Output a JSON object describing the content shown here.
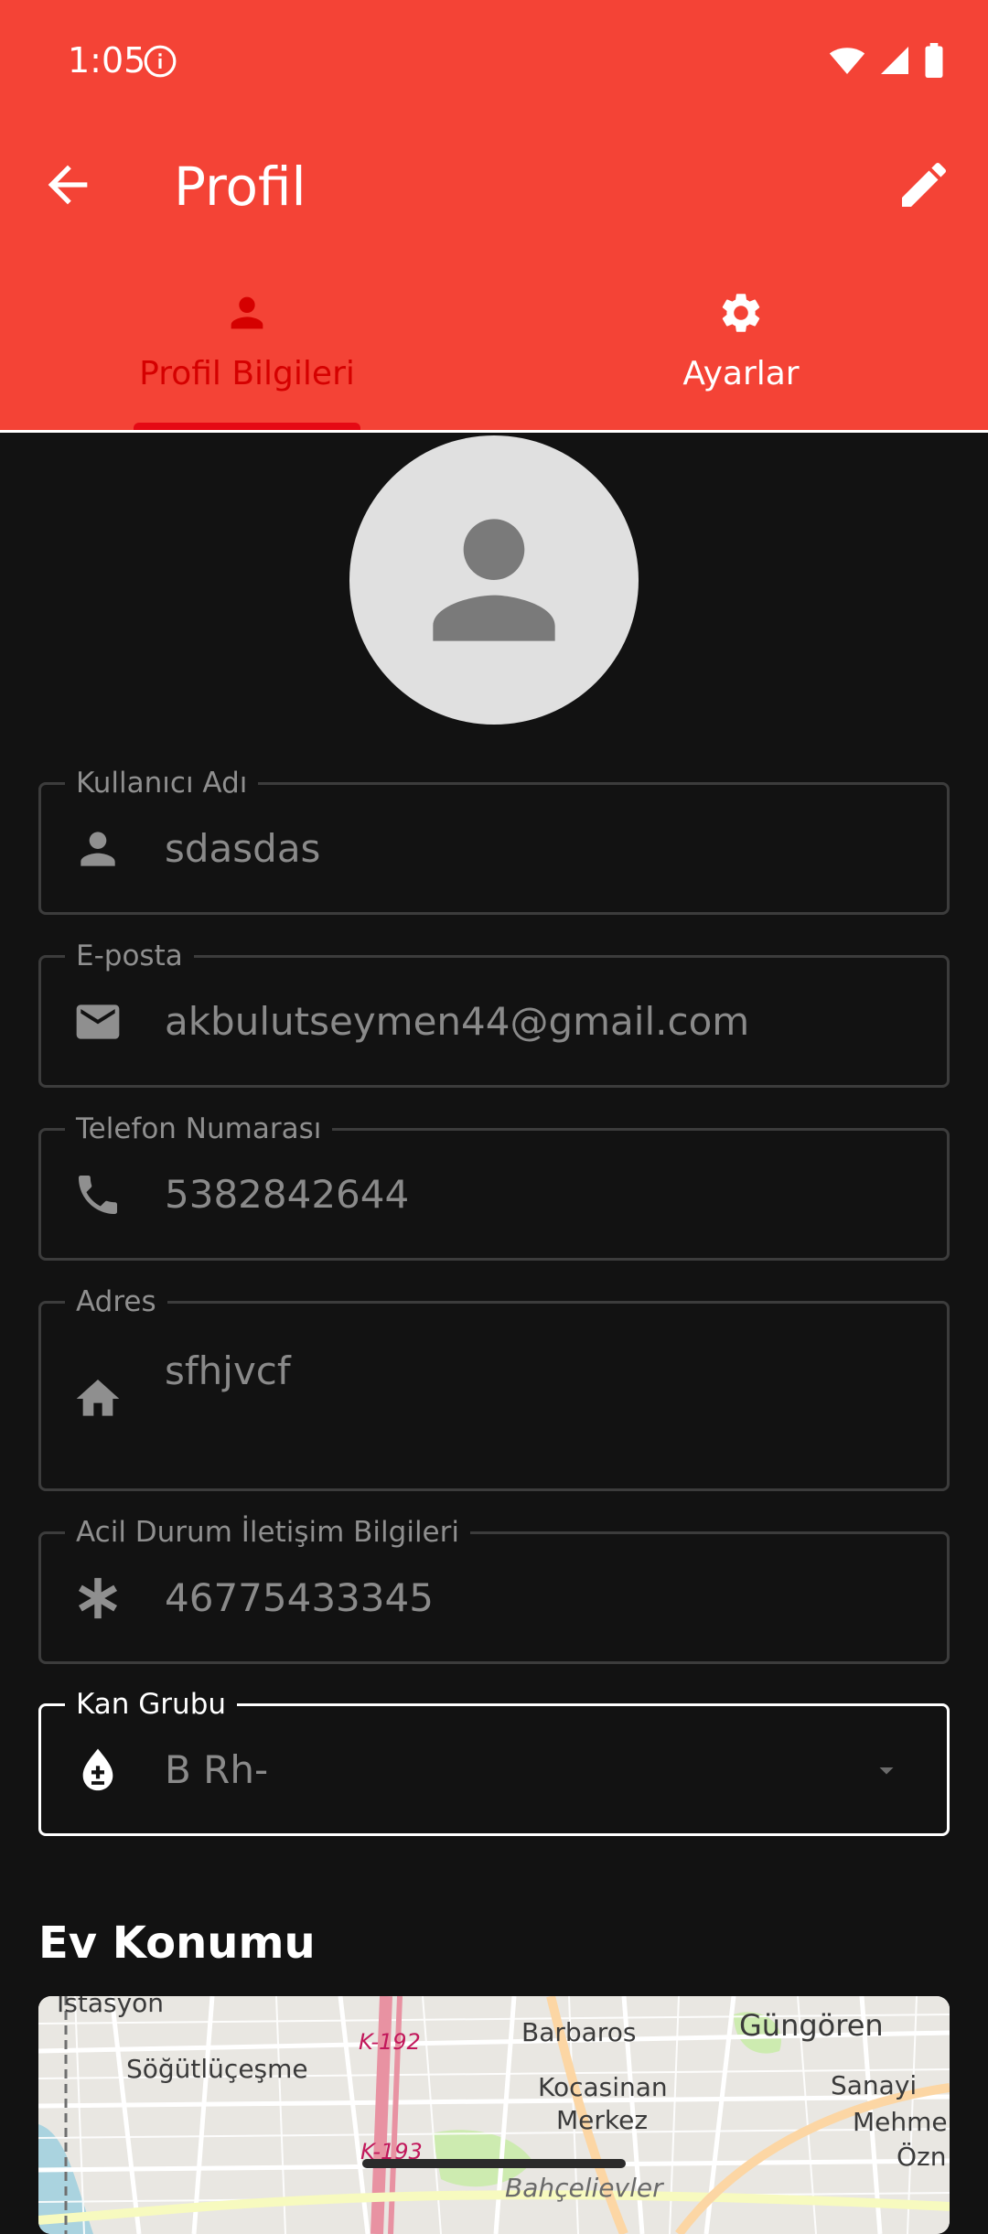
{
  "status_bar": {
    "time": "1:05",
    "icons": [
      "info-icon",
      "wifi-icon",
      "signal-icon",
      "battery-icon"
    ]
  },
  "app_bar": {
    "title": "Profil",
    "back_icon": "arrow-back-icon",
    "edit_icon": "edit-icon",
    "color": "#f44336"
  },
  "tabs": [
    {
      "label": "Profil Bilgileri",
      "icon": "person-icon",
      "selected": true
    },
    {
      "label": "Ayarlar",
      "icon": "settings-icon",
      "selected": false
    }
  ],
  "avatar": {
    "icon": "person-icon"
  },
  "fields": {
    "username": {
      "label": "Kullanıcı Adı",
      "value": "sdasdas",
      "icon": "person-icon"
    },
    "email": {
      "label": "E-posta",
      "value": "akbulutseymen44@gmail.com",
      "icon": "mail-icon"
    },
    "phone": {
      "label": "Telefon Numarası",
      "value": "5382842644",
      "icon": "phone-icon"
    },
    "address": {
      "label": "Adres",
      "value": "sfhjvcf",
      "icon": "home-icon"
    },
    "emergency": {
      "label": "Acil Durum İletişim Bilgileri",
      "value": "46775433345",
      "icon": "asterisk-icon"
    },
    "blood_group": {
      "label": "Kan Grubu",
      "value": "B Rh-",
      "icon": "blood-drop-icon"
    }
  },
  "section": {
    "title": "Ev Konumu"
  },
  "map": {
    "labels": {
      "istasyon": "İstasyon",
      "sogutlucesme": "Söğütlüçeşme",
      "barbaros": "Barbaros",
      "gungoren": "Güngören",
      "kocasinan": "Kocasinan",
      "merkez": "Merkez",
      "sanayi": "Sanayi",
      "mehme": "Mehme",
      "ozn": "Özn",
      "bahcelievler": "Bahçelievler"
    },
    "roads": {
      "k192": "K-192",
      "k193": "K-193"
    }
  }
}
